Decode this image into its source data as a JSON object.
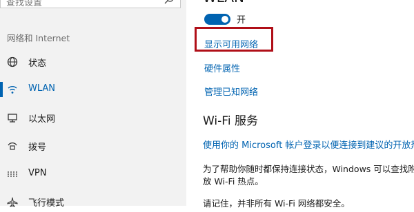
{
  "search": {
    "placeholder": "查找设置"
  },
  "sidebar": {
    "section_title": "网络和 Internet",
    "items": [
      {
        "label": "状态",
        "icon": "globe-icon"
      },
      {
        "label": "WLAN",
        "icon": "wifi-icon",
        "active": true
      },
      {
        "label": "以太网",
        "icon": "ethernet-icon"
      },
      {
        "label": "拨号",
        "icon": "dialup-icon"
      },
      {
        "label": "VPN",
        "icon": "vpn-icon"
      },
      {
        "label": "飞行模式",
        "icon": "airplane-icon"
      }
    ]
  },
  "main": {
    "title": "WLAN",
    "toggle": {
      "state_label": "开",
      "on": true
    },
    "links": {
      "show_networks": "显示可用网络",
      "hardware_properties": "硬件属性",
      "manage_known": "管理已知网络"
    },
    "wifi_services": {
      "heading": "Wi-Fi 服务",
      "link": "使用你的 Microsoft 帐户登录以便连接到建议的开放热",
      "desc_line1": "为了帮助你随时都保持连接状态，Windows 可以查找附",
      "desc_line2": "放 Wi-Fi 热点。",
      "note": "请记住，并非所有 Wi-Fi 网络都安全。"
    }
  },
  "colors": {
    "accent": "#0063b1",
    "highlight": "#b00f18",
    "sidebar_bg": "#f2f2f2"
  }
}
